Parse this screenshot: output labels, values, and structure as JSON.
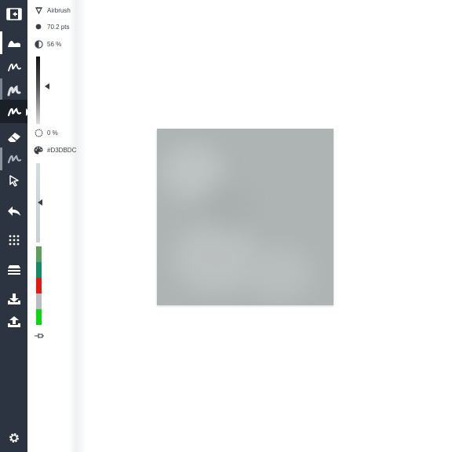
{
  "brush": {
    "name": "Airbrush",
    "size_label": "70.2 pts",
    "opacity_label": "56 %",
    "hardness_label": "0 %",
    "color_label": "#D3DBDC",
    "color_hex": "#D3DBDC",
    "opacity_level": 0.56,
    "hardness_level": 0.0
  },
  "toolbar": {
    "active_tool": "pen-3",
    "icons": [
      "panel-toggle-icon",
      "brush-stroke-icon",
      "pen-icon",
      "calligraphy-icon",
      "airbrush-icon",
      "eraser-icon",
      "smudge-icon",
      "select-arrow-icon",
      "undo-icon",
      "grid-icon",
      "layers-icon",
      "download-icon",
      "upload-icon",
      "settings-icon"
    ]
  },
  "palette": {
    "colors": [
      "#5e9e5e",
      "#138a6a",
      "#e01b12",
      "#b8bec4",
      "#0fd613"
    ]
  },
  "canvas": {
    "fill": "#AEB3B3"
  }
}
